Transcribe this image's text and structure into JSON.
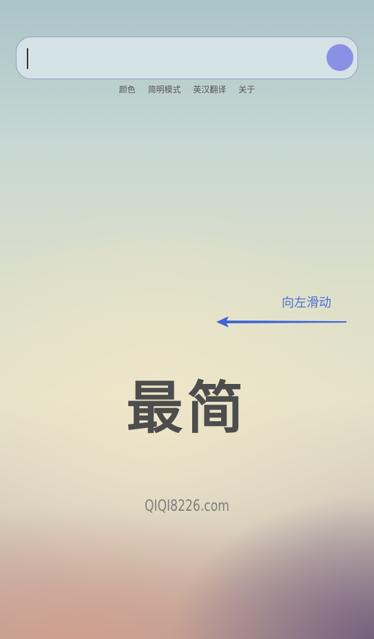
{
  "search": {
    "value": "",
    "placeholder": ""
  },
  "menu": {
    "items": [
      "颜色",
      "简明模式",
      "英汉翻译",
      "关于"
    ]
  },
  "hint": {
    "text": "向左滑动"
  },
  "logo": {
    "main": "最简",
    "sub": "QIQI8226.com"
  },
  "colors": {
    "accent": "#8b90e6",
    "hint": "#4a6fd6",
    "logo": "#4d4d4d"
  },
  "icons": {
    "arrow": "left-arrow-icon",
    "search_button": "search-button"
  }
}
